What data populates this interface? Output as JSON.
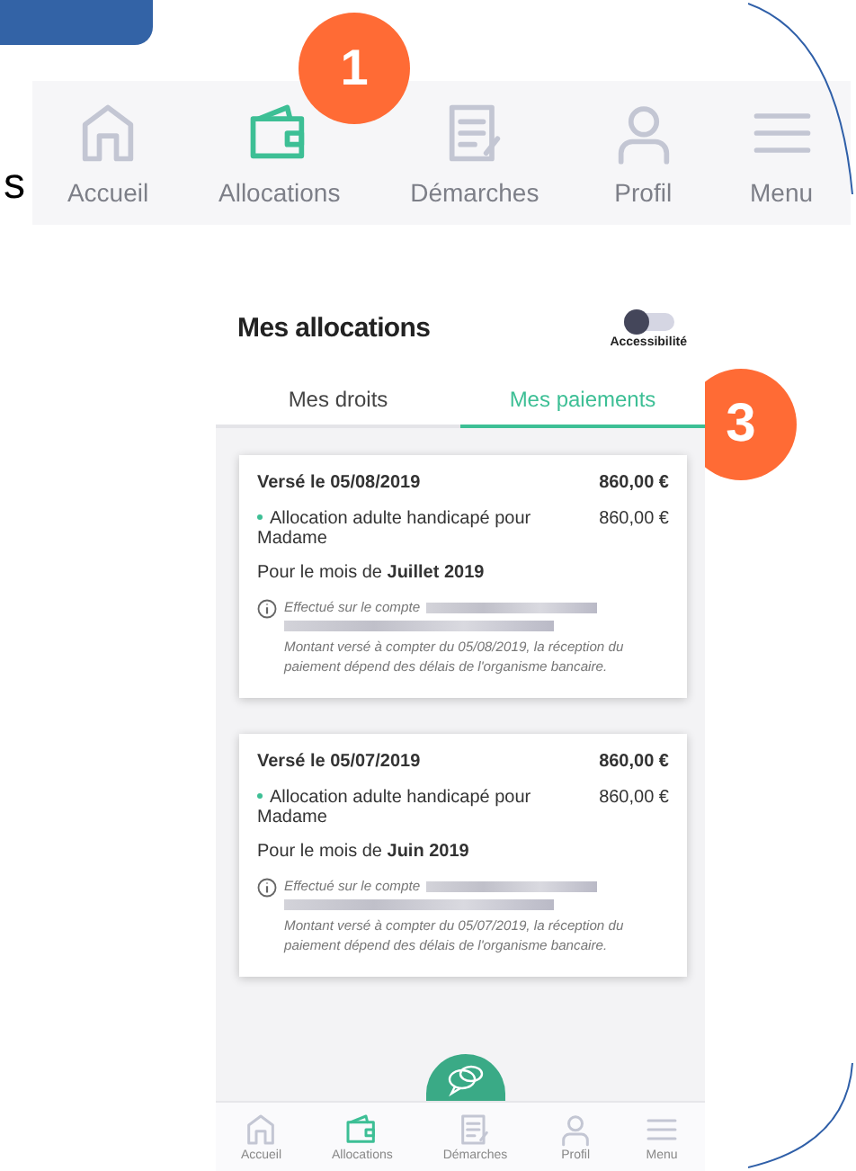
{
  "cut_text": "s",
  "top_nav": [
    {
      "label": "Accueil",
      "selected": false
    },
    {
      "label": "Allocations",
      "selected": true
    },
    {
      "label": "Démarches",
      "selected": false
    },
    {
      "label": "Profil",
      "selected": false
    },
    {
      "label": "Menu",
      "selected": false
    }
  ],
  "badges": [
    "1",
    "3"
  ],
  "screen": {
    "title": "Mes allocations",
    "accessibility": {
      "label": "Accessibilité",
      "on": false
    },
    "tabs": [
      {
        "label": "Mes droits",
        "selected": false
      },
      {
        "label": "Mes paiements",
        "selected": true
      }
    ],
    "payments": [
      {
        "date": "Versé le 05/08/2019",
        "total": "860,00 €",
        "item": "Allocation adulte handicapé pour Madame",
        "amount": "860,00 €",
        "month": "Pour le mois de **Juillet 2019**",
        "info_prefix": "Effectué sur le compte",
        "info_text": "Montant versé à compter du 05/08/2019, la réception du paiement dépend des délais de l'organisme bancaire."
      },
      {
        "date": "Versé le 05/07/2019",
        "total": "860,00 €",
        "item": "Allocation adulte handicapé pour Madame",
        "amount": "860,00 €",
        "month": "Pour le mois de **Juin 2019**",
        "info_prefix": "Effectué sur le compte",
        "info_text": "Montant versé à compter du 05/07/2019, la réception du paiement dépend des délais de l'organisme bancaire."
      }
    ],
    "bottom_nav": [
      {
        "label": "Accueil",
        "selected": false
      },
      {
        "label": "Allocations",
        "selected": true
      },
      {
        "label": "Démarches",
        "selected": false
      },
      {
        "label": "Profil",
        "selected": false
      },
      {
        "label": "Menu",
        "selected": false
      }
    ]
  }
}
